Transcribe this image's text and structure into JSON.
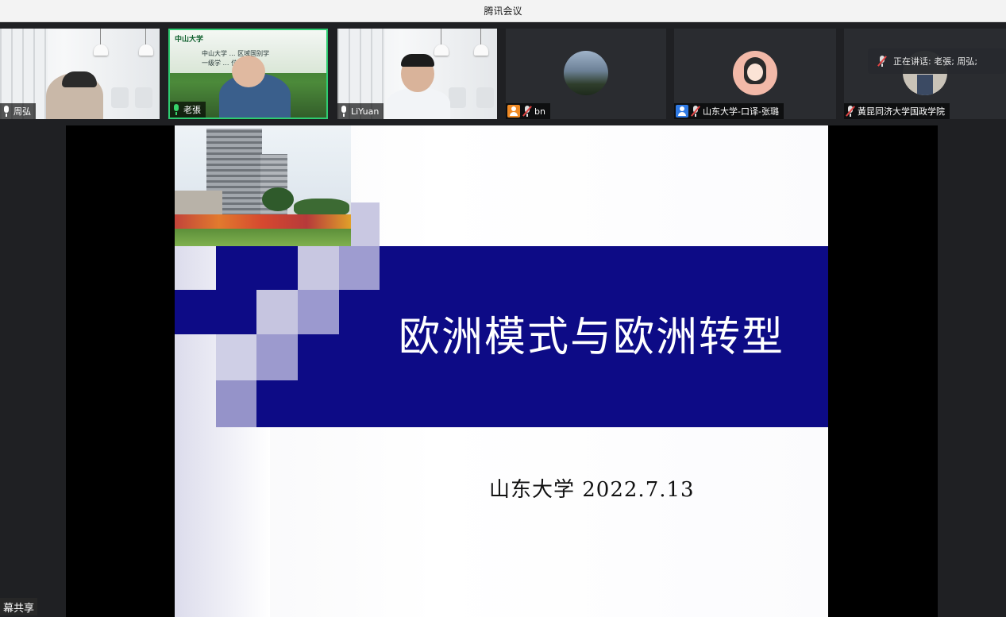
{
  "window": {
    "title": "腾讯会议"
  },
  "participants": [
    {
      "name": "周弘",
      "mic": "on"
    },
    {
      "name": "老張",
      "mic": "active"
    },
    {
      "name": "LiYuan",
      "mic": "on"
    },
    {
      "name": "bn",
      "mic": "off"
    },
    {
      "name": "山东大学-口译-张璐",
      "mic": "off"
    },
    {
      "name": "黃昆同济大学国政学院",
      "mic": "off"
    }
  ],
  "tile2_banner": {
    "logo": "中山大学",
    "line1": "中山大学 … 区域国别学",
    "line2": "一级学 … 位授权点"
  },
  "speaking_indicator": {
    "text": "正在讲话: 老張; 周弘;"
  },
  "slide": {
    "title": "欧洲模式与欧洲转型",
    "subtitle": "山东大学 2022.7.13"
  },
  "screen_share_tag": "幕共享",
  "colors": {
    "slide_band": "#0d0b86",
    "active_border": "#2ecc71",
    "user_icon_orange": "#f08a24",
    "user_icon_blue": "#2f7ae5"
  }
}
